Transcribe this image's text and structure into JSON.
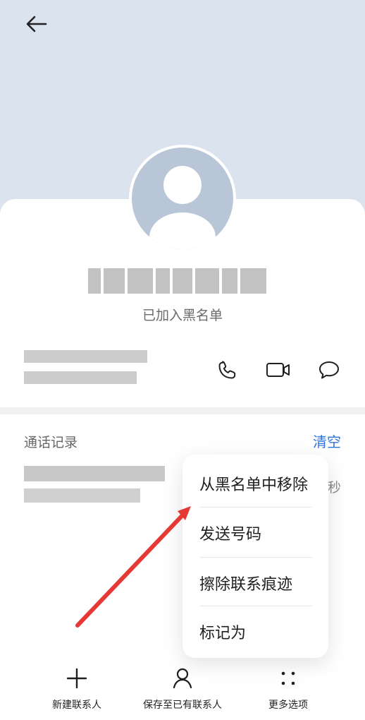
{
  "header": {
    "back_icon": "arrow-left-icon"
  },
  "contact": {
    "avatar_icon": "person-avatar-icon",
    "status": "已加入黑名单"
  },
  "actions": {
    "call_icon": "phone-icon",
    "video_icon": "video-camera-icon",
    "message_icon": "message-icon"
  },
  "history": {
    "title": "通话记录",
    "clear_label": "清空",
    "duration_suffix": "秒"
  },
  "menu": {
    "items": [
      {
        "label": "从黑名单中移除"
      },
      {
        "label": "发送号码"
      },
      {
        "label": "擦除联系痕迹"
      },
      {
        "label": "标记为"
      }
    ]
  },
  "bottom_nav": {
    "items": [
      {
        "label": "新建联系人",
        "icon": "plus-icon"
      },
      {
        "label": "保存至已有联系人",
        "icon": "person-icon"
      },
      {
        "label": "更多选项",
        "icon": "more-icon"
      }
    ]
  },
  "colors": {
    "accent": "#2f73d9",
    "arrow": "#e53935",
    "header_bg": "#dbe3ee"
  }
}
